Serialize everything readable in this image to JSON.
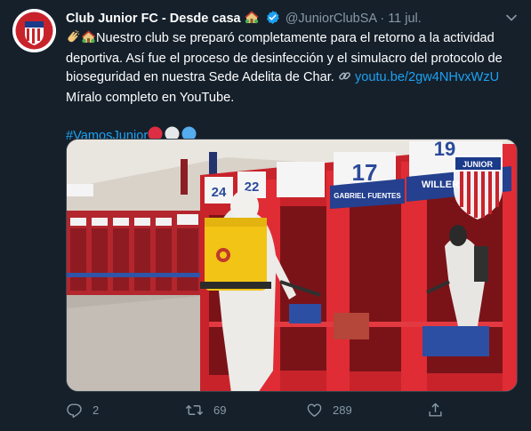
{
  "tweet": {
    "author_name": "Club Junior FC - Desde casa",
    "author_name_emoji": "house-with-garden",
    "verified_icon": "verified-badge-icon",
    "handle": "@JuniorClubSA",
    "separator": "·",
    "date": "11 jul.",
    "text_line1": "Nuestro club se preparó completamente para el retorno a la actividad",
    "text_line2": "deportiva. Así fue el proceso de desinfección y el simulacro del protocolo de",
    "text_line3": "bioseguridad en nuestra Sede Adelita de Char. ",
    "link_text": "youtu.be/2gw4NHvxWzU",
    "text_line4": "Míralo completo en YouTube.",
    "hashtag": "#VamosJunior",
    "hashtag_emojis": [
      "red-circle",
      "white-circle",
      "blue-circle"
    ]
  },
  "media": {
    "locker_numbers": [
      "24",
      "22",
      "17",
      "19"
    ],
    "locker_names": [
      "GABRIEL FUENTES",
      "WILLER"
    ],
    "logo_text": "JUNIOR"
  },
  "actions": {
    "reply_count": "2",
    "retweet_count": "69",
    "like_count": "289"
  },
  "colors": {
    "background": "#15202b",
    "text": "#ffffff",
    "secondary": "#8899a6",
    "link": "#1da1f2",
    "locker_red": "#c8232b"
  }
}
